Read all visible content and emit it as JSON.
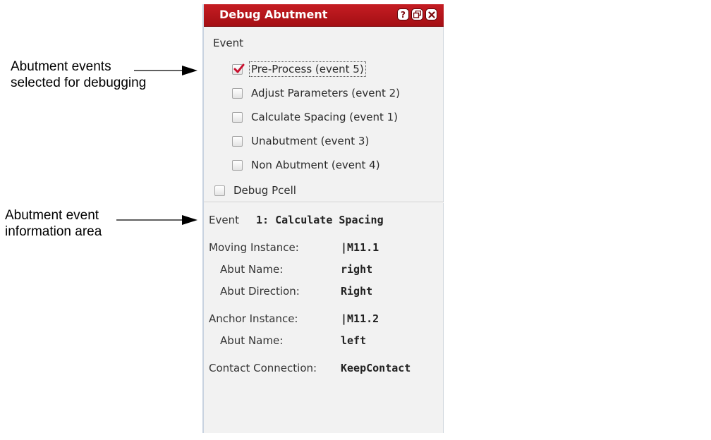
{
  "annotations": {
    "events_selected": [
      "Abutment events",
      "selected for debugging"
    ],
    "info_area": [
      "Abutment event",
      "information area"
    ]
  },
  "window": {
    "title": "Debug Abutment",
    "buttons": [
      {
        "name": "help",
        "icon": "help-icon",
        "glyph": "?"
      },
      {
        "name": "restore",
        "icon": "restore-icon"
      },
      {
        "name": "close",
        "icon": "close-icon"
      }
    ]
  },
  "event_section": {
    "label": "Event",
    "events": [
      {
        "label": "Pre-Process (event 5)",
        "checked": true,
        "focused": true
      },
      {
        "label": "Adjust Parameters (event 2)",
        "checked": false,
        "focused": false
      },
      {
        "label": "Calculate Spacing (event 1)",
        "checked": false,
        "focused": false
      },
      {
        "label": "Unabutment (event 3)",
        "checked": false,
        "focused": false
      },
      {
        "label": "Non Abutment (event 4)",
        "checked": false,
        "focused": false
      }
    ],
    "debug_pcell": {
      "label": "Debug Pcell",
      "checked": false
    }
  },
  "info": {
    "event_label": "Event",
    "event_value": "1: Calculate Spacing",
    "moving_instance_label": "Moving Instance:",
    "moving_instance_value": "|M11.1",
    "moving_abut_name_label": "Abut Name:",
    "moving_abut_name_value": "right",
    "moving_abut_direction_label": "Abut Direction:",
    "moving_abut_direction_value": "Right",
    "anchor_instance_label": "Anchor Instance:",
    "anchor_instance_value": "|M11.2",
    "anchor_abut_name_label": "Abut Name:",
    "anchor_abut_name_value": "left",
    "contact_connection_label": "Contact Connection:",
    "contact_connection_value": "KeepContact"
  },
  "colors": {
    "titlebar": "#b5151b",
    "check_mark": "#c8102e",
    "panel_bg": "#f2f2f2"
  }
}
